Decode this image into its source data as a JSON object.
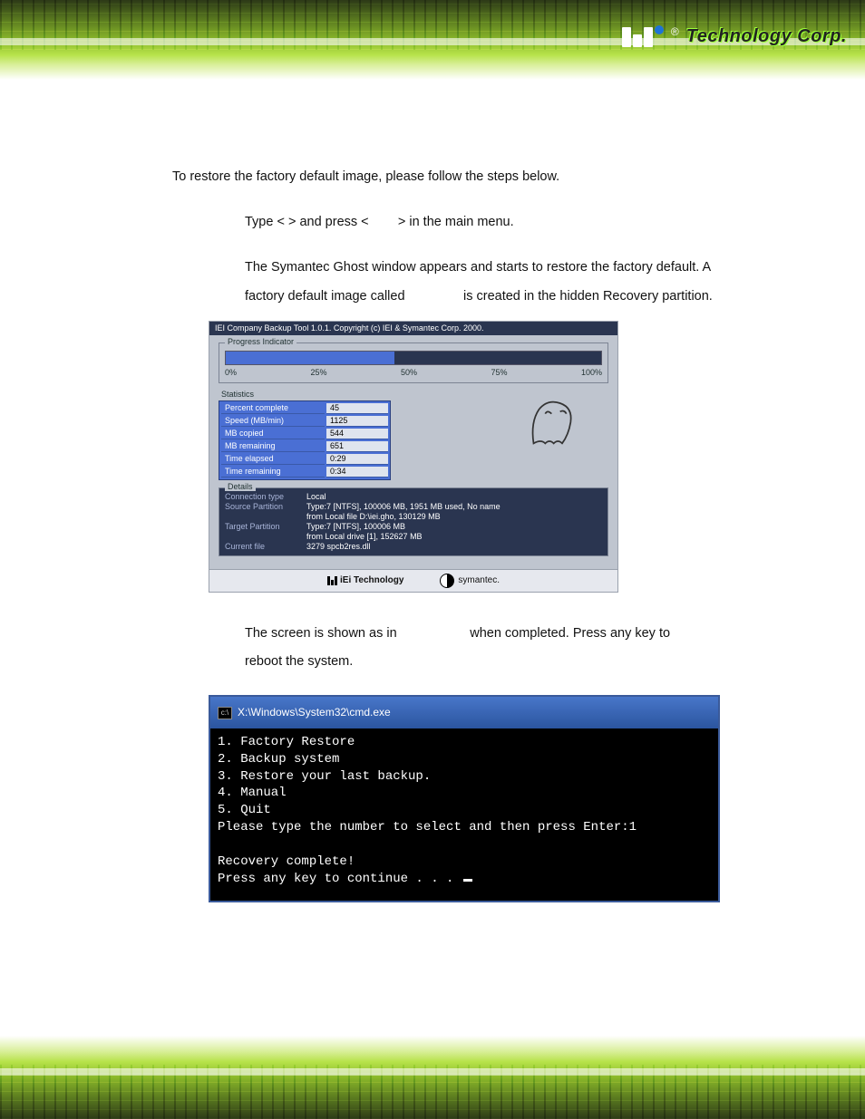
{
  "header": {
    "brand_text": "Technology Corp."
  },
  "body": {
    "intro": "To restore the factory default image, please follow the steps below.",
    "step1_a": "Type <",
    "step1_b": "> and press <",
    "step1_c": "> in the main menu.",
    "step2_a": "The Symantec Ghost window appears and starts to restore the factory default. A",
    "step2_b": "factory default image called",
    "step2_c": "is created in the hidden Recovery partition.",
    "step3_a": "The screen is shown as in",
    "step3_b": "when completed. Press any key to",
    "step3_c": "reboot the system."
  },
  "ghost": {
    "title": "IEI Company Backup Tool 1.0.1.   Copyright (c) IEI & Symantec Corp. 2000.",
    "progress_label": "Progress Indicator",
    "ticks": [
      "0%",
      "25%",
      "50%",
      "75%",
      "100%"
    ],
    "stats_label": "Statistics",
    "stats": [
      [
        "Percent complete",
        "45"
      ],
      [
        "Speed (MB/min)",
        "1125"
      ],
      [
        "MB copied",
        "544"
      ],
      [
        "MB remaining",
        "651"
      ],
      [
        "Time elapsed",
        "0:29"
      ],
      [
        "Time remaining",
        "0:34"
      ]
    ],
    "details_label": "Details",
    "details": [
      [
        "Connection type",
        "Local"
      ],
      [
        "Source Partition",
        "Type:7 [NTFS], 100006 MB, 1951 MB used, No name"
      ],
      [
        "",
        "from Local file D:\\iei.gho, 130129 MB"
      ],
      [
        "Target Partition",
        "Type:7 [NTFS], 100006 MB"
      ],
      [
        "",
        "from Local drive [1], 152627 MB"
      ],
      [
        "Current file",
        "3279 spcb2res.dll"
      ]
    ],
    "footer_iei": "iEi Technology",
    "footer_symantec": "symantec."
  },
  "cmd": {
    "title": "X:\\Windows\\System32\\cmd.exe",
    "lines": "1. Factory Restore\n2. Backup system\n3. Restore your last backup.\n4. Manual\n5. Quit\nPlease type the number to select and then press Enter:1\n\nRecovery complete!\nPress any key to continue . . . "
  }
}
